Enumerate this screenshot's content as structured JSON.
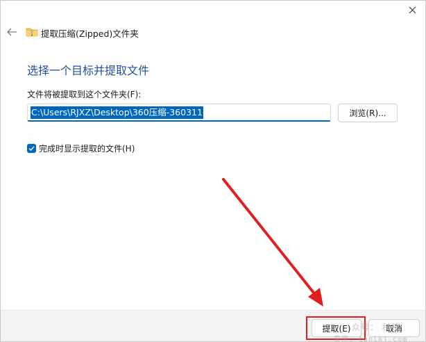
{
  "window": {
    "title": "提取压缩(Zipped)文件夹"
  },
  "main": {
    "heading": "选择一个目标并提取文件",
    "folder_label": "文件将被提取到这个文件夹(F):",
    "path_value": "C:\\Users\\RJXZ\\Desktop\\360压缩-360311",
    "browse_label": "浏览(R)...",
    "show_files_label": "完成时显示提取的文件(H)",
    "show_files_checked": true
  },
  "footer": {
    "extract_label": "提取(E)",
    "cancel_label": "取消"
  },
  "watermark": {
    "line1": "众号：  科技",
    "line2": "官网: tanlkj.com"
  },
  "colors": {
    "accent": "#0067c0",
    "heading": "#1f4e9c",
    "annotation": "#e02020"
  },
  "icons": {
    "close": "close-icon",
    "back": "back-arrow-icon",
    "folder": "zip-folder-icon",
    "check": "check-icon"
  }
}
